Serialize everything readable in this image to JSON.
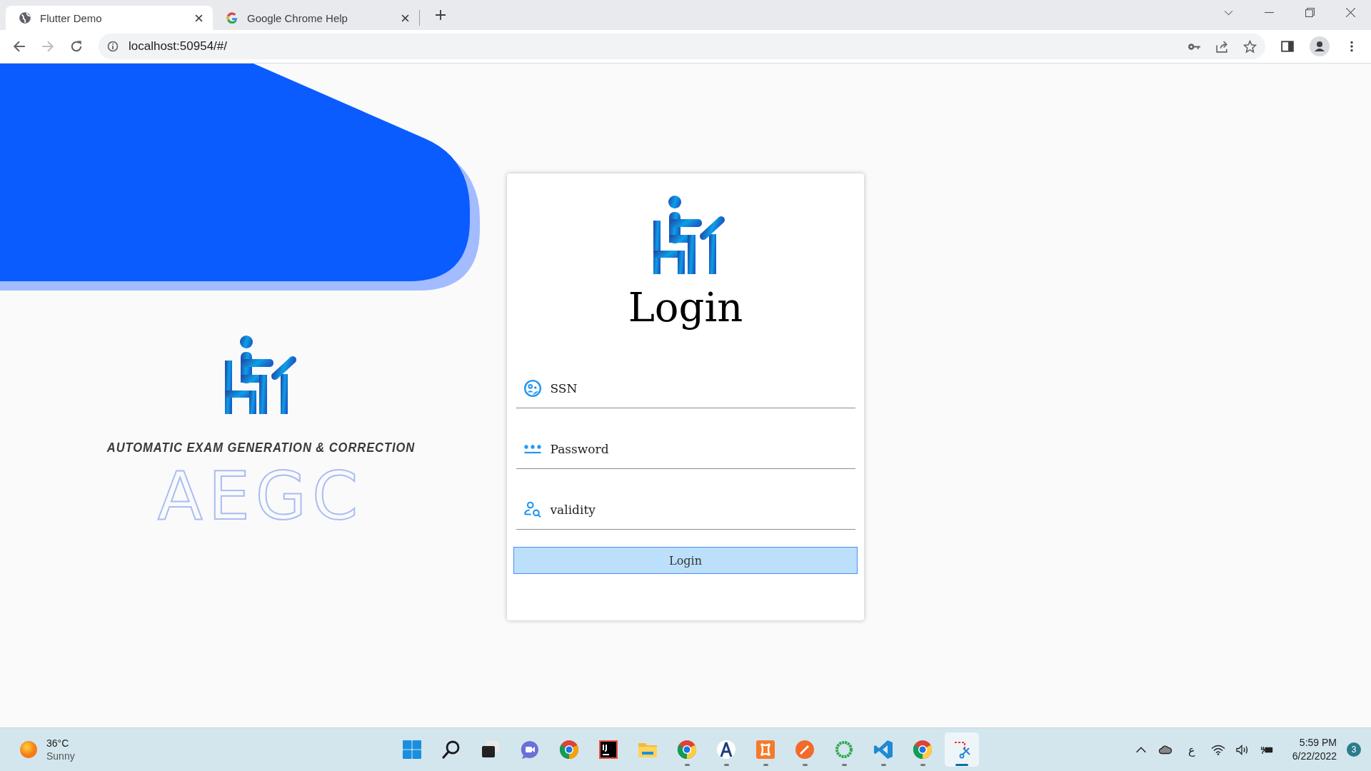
{
  "browser": {
    "tabs": [
      {
        "title": "Flutter Demo",
        "kind": "globe",
        "selected": true
      },
      {
        "title": "Google Chrome Help",
        "kind": "google",
        "selected": false
      }
    ],
    "address": "localhost:50954/#/"
  },
  "brand": {
    "tagline": "AUTOMATIC EXAM GENERATION & CORRECTION",
    "acronym": "AEGC"
  },
  "login": {
    "title": "Login",
    "fields": [
      {
        "kind": "person",
        "placeholder": "SSN"
      },
      {
        "kind": "password",
        "placeholder": "Password"
      },
      {
        "kind": "search-person",
        "placeholder": "validity"
      }
    ],
    "button": "Login"
  },
  "taskbar": {
    "weather": {
      "temp": "36°C",
      "condition": "Sunny"
    },
    "apps": [
      {
        "kind": "start",
        "running": false,
        "selected": false
      },
      {
        "kind": "search",
        "running": false,
        "selected": false
      },
      {
        "kind": "taskview",
        "running": false,
        "selected": false
      },
      {
        "kind": "chat",
        "running": false,
        "selected": false
      },
      {
        "kind": "chrome-dev",
        "running": false,
        "selected": false
      },
      {
        "kind": "intellij",
        "running": false,
        "selected": false
      },
      {
        "kind": "explorer",
        "running": false,
        "selected": false
      },
      {
        "kind": "chrome",
        "running": true,
        "selected": false
      },
      {
        "kind": "studio",
        "running": true,
        "selected": false
      },
      {
        "kind": "xampp",
        "running": true,
        "selected": false
      },
      {
        "kind": "postman",
        "running": true,
        "selected": false
      },
      {
        "kind": "ring",
        "running": true,
        "selected": false
      },
      {
        "kind": "vscode",
        "running": true,
        "selected": false
      },
      {
        "kind": "chrome",
        "running": true,
        "selected": false
      },
      {
        "kind": "snip",
        "running": true,
        "selected": true
      }
    ],
    "tray": {
      "language": "ع",
      "time": "5:59 PM",
      "date": "6/22/2022",
      "notifications": "3"
    }
  }
}
